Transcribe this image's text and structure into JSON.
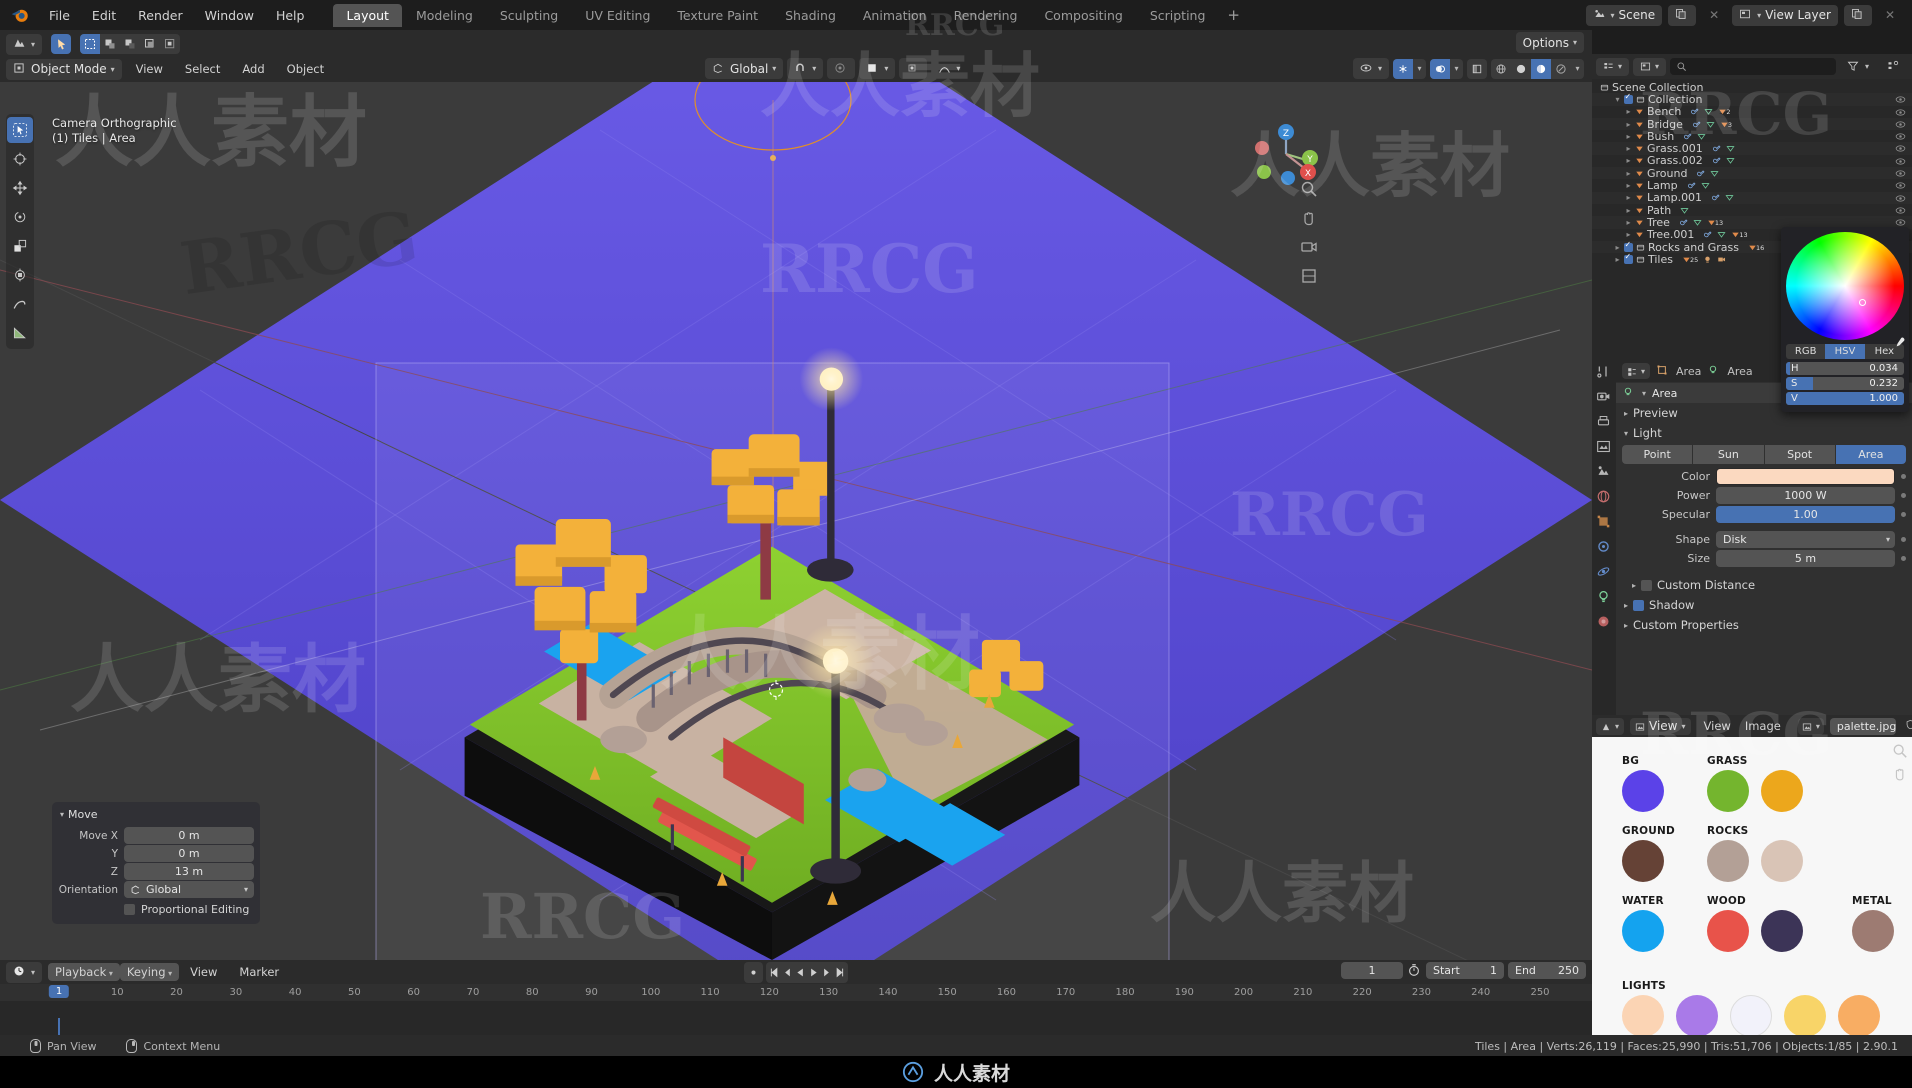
{
  "topbar": {
    "menus": [
      "File",
      "Edit",
      "Render",
      "Window",
      "Help"
    ],
    "workspaces": [
      {
        "label": "Layout",
        "active": true
      },
      {
        "label": "Modeling",
        "active": false
      },
      {
        "label": "Sculpting",
        "active": false
      },
      {
        "label": "UV Editing",
        "active": false
      },
      {
        "label": "Texture Paint",
        "active": false
      },
      {
        "label": "Shading",
        "active": false
      },
      {
        "label": "Animation",
        "active": false
      },
      {
        "label": "Rendering",
        "active": false
      },
      {
        "label": "Compositing",
        "active": false
      },
      {
        "label": "Scripting",
        "active": false
      }
    ],
    "add_workspace": "+",
    "scene_name": "Scene",
    "view_layer_name": "View Layer"
  },
  "viewport": {
    "mode": "Object Mode",
    "menus": [
      "View",
      "Select",
      "Add",
      "Object"
    ],
    "transform_orientation": "Global",
    "options_label": "Options",
    "overlay_line1": "Camera Orthographic",
    "overlay_line2": "(1) Tiles | Area",
    "gizmo_axes": [
      "Z",
      "Y",
      "X"
    ],
    "background_color": "#3b3b3b",
    "scene_bg_color": "#5b4fd9"
  },
  "operator_panel": {
    "title": "Move",
    "rows": [
      {
        "label": "Move X",
        "value": "0 m"
      },
      {
        "label": "Y",
        "value": "0 m"
      },
      {
        "label": "Z",
        "value": "13 m"
      }
    ],
    "orientation_label": "Orientation",
    "orientation_value": "Global",
    "proportional_editing": "Proportional Editing"
  },
  "timeline": {
    "menus": [
      "Playback",
      "Keying",
      "View",
      "Marker"
    ],
    "ticks": [
      10,
      20,
      30,
      40,
      50,
      60,
      70,
      80,
      90,
      100,
      110,
      120,
      130,
      140,
      150,
      160,
      170,
      180,
      190,
      200,
      210,
      220,
      230,
      240,
      250
    ],
    "current_frame": 1,
    "current_frame_field": "1",
    "start_label": "Start",
    "start_value": "1",
    "end_label": "End",
    "end_value": "250"
  },
  "statusbar": {
    "hints": [
      {
        "icon": "mouse-middle-icon",
        "label": "Pan View"
      },
      {
        "icon": "mouse-right-icon",
        "label": "Context Menu"
      }
    ],
    "stats": "Tiles | Area | Verts:26,119 | Faces:25,990 | Tris:51,706 | Objects:1/85 | 2.90.1"
  },
  "outliner": {
    "search_placeholder": "",
    "scene_collection": "Scene Collection",
    "items": [
      {
        "name": "Collection",
        "depth": 1,
        "kind": "collection",
        "checkbox": true,
        "expanded": true,
        "badges": []
      },
      {
        "name": "Bench",
        "depth": 2,
        "kind": "object",
        "checkbox": false,
        "expanded": false,
        "badges": [
          "modifier",
          "mesh",
          "mesh-count-2"
        ]
      },
      {
        "name": "Bridge",
        "depth": 2,
        "kind": "object",
        "checkbox": false,
        "expanded": false,
        "badges": [
          "modifier",
          "mesh",
          "mesh-count-3"
        ]
      },
      {
        "name": "Bush",
        "depth": 2,
        "kind": "object",
        "checkbox": false,
        "expanded": false,
        "badges": [
          "modifier",
          "mesh"
        ]
      },
      {
        "name": "Grass.001",
        "depth": 2,
        "kind": "object",
        "checkbox": false,
        "expanded": false,
        "badges": [
          "modifier",
          "mesh"
        ]
      },
      {
        "name": "Grass.002",
        "depth": 2,
        "kind": "object",
        "checkbox": false,
        "expanded": false,
        "badges": [
          "modifier",
          "mesh"
        ]
      },
      {
        "name": "Ground",
        "depth": 2,
        "kind": "object",
        "checkbox": false,
        "expanded": false,
        "badges": [
          "modifier",
          "mesh"
        ]
      },
      {
        "name": "Lamp",
        "depth": 2,
        "kind": "object",
        "checkbox": false,
        "expanded": false,
        "badges": [
          "modifier",
          "mesh"
        ]
      },
      {
        "name": "Lamp.001",
        "depth": 2,
        "kind": "object",
        "checkbox": false,
        "expanded": false,
        "badges": [
          "modifier",
          "mesh"
        ]
      },
      {
        "name": "Path",
        "depth": 2,
        "kind": "object",
        "checkbox": false,
        "expanded": false,
        "badges": [
          "mesh"
        ]
      },
      {
        "name": "Tree",
        "depth": 2,
        "kind": "object",
        "checkbox": false,
        "expanded": false,
        "badges": [
          "modifier",
          "mesh",
          "mesh-count-13"
        ]
      },
      {
        "name": "Tree.001",
        "depth": 2,
        "kind": "object",
        "checkbox": false,
        "expanded": false,
        "badges": [
          "modifier",
          "mesh",
          "mesh-count-13"
        ]
      },
      {
        "name": "Rocks and Grass",
        "depth": 1,
        "kind": "collection",
        "checkbox": true,
        "expanded": false,
        "badges": [
          "mesh-count-16"
        ]
      },
      {
        "name": "Tiles",
        "depth": 1,
        "kind": "collection",
        "checkbox": true,
        "expanded": false,
        "badges": [
          "mesh-count-25",
          "light",
          "camera"
        ]
      }
    ]
  },
  "properties": {
    "breadcrumb_object": "Area",
    "breadcrumb_data": "Area",
    "datablock_name": "Area",
    "sections": [
      {
        "label": "Preview",
        "expanded": false
      },
      {
        "label": "Light",
        "expanded": true
      }
    ],
    "light_types": [
      {
        "label": "Point",
        "active": false
      },
      {
        "label": "Sun",
        "active": false
      },
      {
        "label": "Spot",
        "active": false
      },
      {
        "label": "Area",
        "active": true
      }
    ],
    "fields": [
      {
        "label": "Color",
        "value": "",
        "style": "color",
        "color": "#fbd9c0"
      },
      {
        "label": "Power",
        "value": "1000 W",
        "style": "text"
      },
      {
        "label": "Specular",
        "value": "1.00",
        "style": "slider-full"
      },
      {
        "label": "Shape",
        "value": "Disk",
        "style": "dropdown"
      },
      {
        "label": "Size",
        "value": "5 m",
        "style": "text"
      }
    ],
    "custom_distance": "Custom Distance",
    "shadow": "Shadow",
    "custom_properties": "Custom Properties",
    "color_picker": {
      "tabs": [
        {
          "label": "RGB",
          "active": false
        },
        {
          "label": "HSV",
          "active": true
        },
        {
          "label": "Hex",
          "active": false
        }
      ],
      "channels": [
        {
          "key": "H",
          "value": "0.034",
          "fill": 0.034
        },
        {
          "key": "S",
          "value": "0.232",
          "fill": 0.232
        },
        {
          "key": "V",
          "value": "1.000",
          "fill": 1.0
        }
      ]
    }
  },
  "image_editor": {
    "menus": [
      "View",
      "Image"
    ],
    "view_dropdown": "View",
    "image_name": "palette.jpg",
    "palette": [
      {
        "label": "BG",
        "colors": [
          "#5b42e8"
        ]
      },
      {
        "label": "GRASS",
        "colors": [
          "#74b52e",
          "#eca71c"
        ]
      },
      {
        "label": "GROUND",
        "colors": [
          "#654236"
        ]
      },
      {
        "label": "ROCKS",
        "colors": [
          "#b3a096",
          "#d9c4b6"
        ]
      },
      {
        "label": "WATER",
        "colors": [
          "#14a3ef"
        ]
      },
      {
        "label": "WOOD",
        "colors": [
          "#e8534a",
          "#3c3457"
        ]
      },
      {
        "label": "METAL",
        "colors": [
          "#9d7b72"
        ]
      },
      {
        "label": "LIGHTS",
        "colors": [
          "#fbd4b4",
          "#a97ae8",
          "#f2f2fa",
          "#f8d468",
          "#f8ad63"
        ]
      }
    ]
  },
  "watermarks": {
    "brand": "RRCG",
    "cn": "人人素材",
    "bottom": "人人素材"
  }
}
